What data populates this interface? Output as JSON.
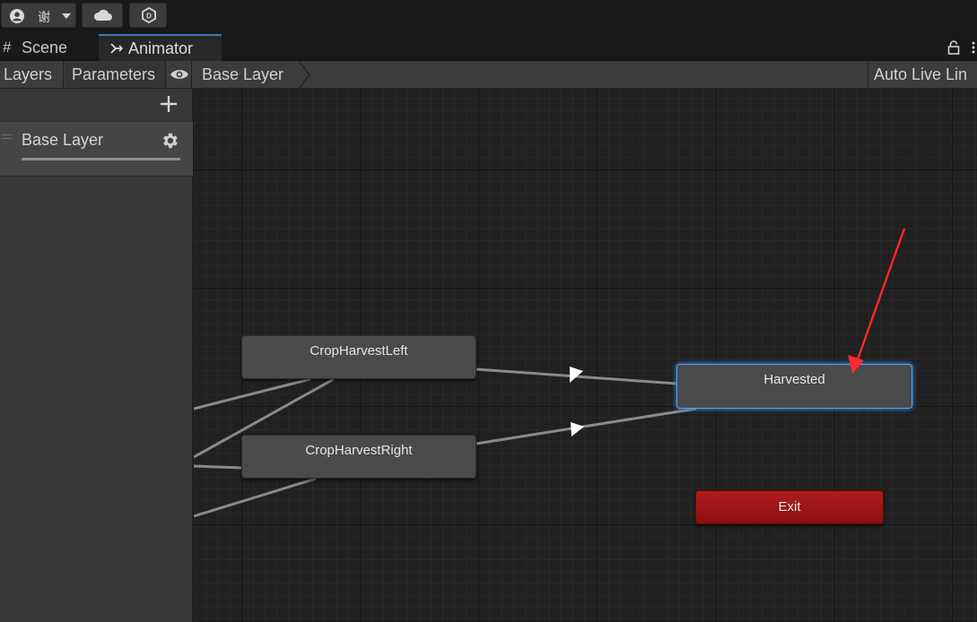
{
  "toolbar": {
    "account_name": "谢",
    "icons": [
      "account-icon",
      "cloud-icon",
      "collab-icon"
    ]
  },
  "tabs": [
    {
      "label": "Scene",
      "icon": "grid-icon",
      "active": false
    },
    {
      "label": "Animator",
      "icon": "animator-icon",
      "active": true
    }
  ],
  "animator_toolbar": {
    "layers_label": "Layers",
    "parameters_label": "Parameters",
    "breadcrumb": "Base Layer",
    "auto_live_link": "Auto Live Lin"
  },
  "layers_panel": {
    "layers": [
      {
        "name": "Base Layer",
        "weight": 1.0
      }
    ]
  },
  "graph": {
    "states": [
      {
        "name": "CropHarvestLeft"
      },
      {
        "name": "CropHarvestRight"
      },
      {
        "name": "Harvested",
        "selected": true
      },
      {
        "name": "Exit"
      }
    ],
    "colors": {
      "state": "#4a4a4c",
      "selected_outline": "#5aa0e8",
      "exit": "#a01818",
      "annotation_arrow": "#ff2a2a",
      "transition": "#8a8a8a"
    }
  }
}
